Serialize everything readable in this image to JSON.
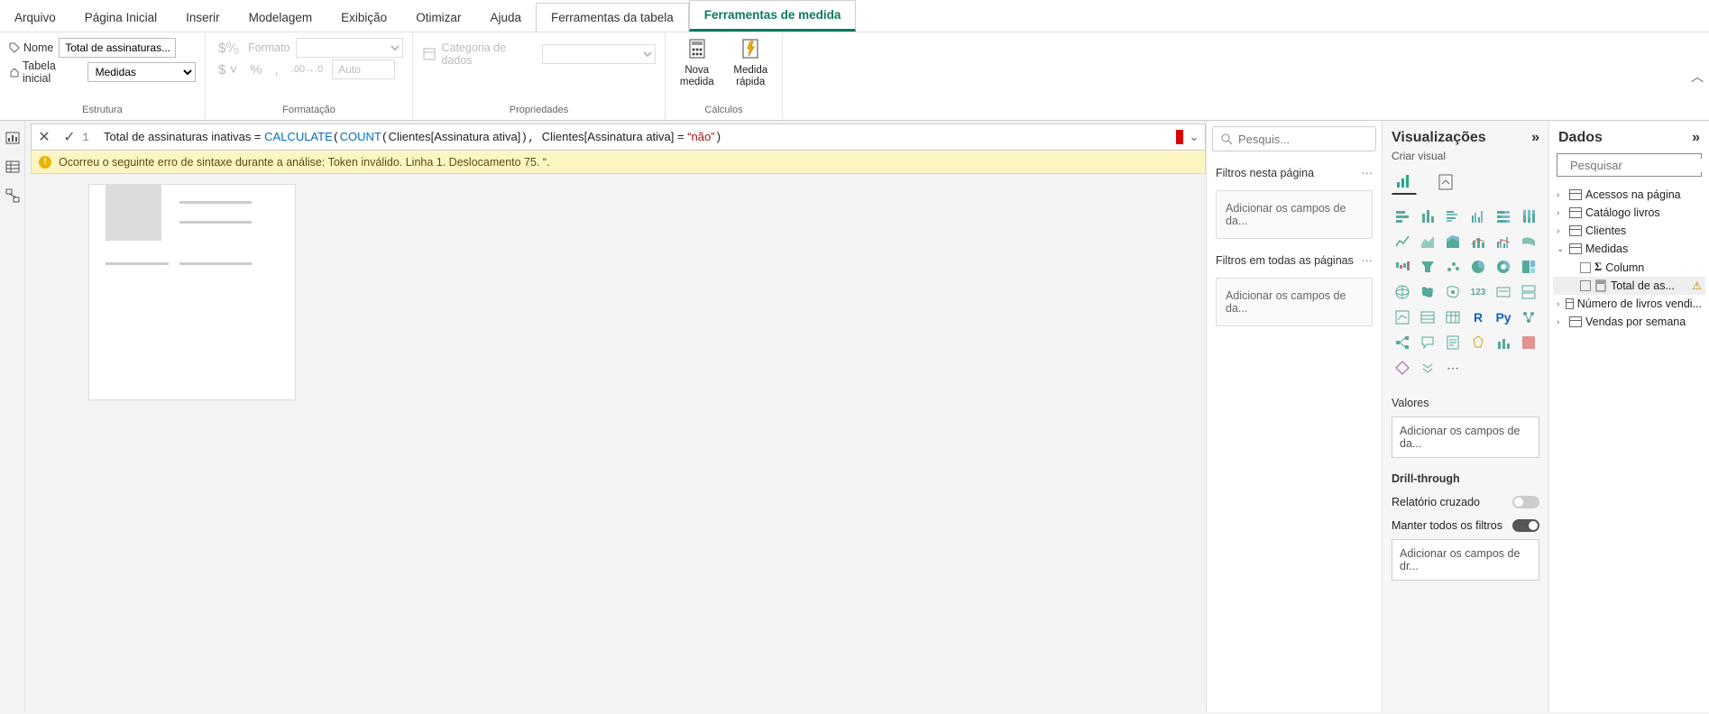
{
  "ribbon": {
    "tabs": [
      "Arquivo",
      "Página Inicial",
      "Inserir",
      "Modelagem",
      "Exibição",
      "Otimizar",
      "Ajuda",
      "Ferramentas da tabela",
      "Ferramentas de medida"
    ],
    "structure": {
      "name_label": "Nome",
      "name_value": "Total de assinaturas...",
      "home_table_label": "Tabela inicial",
      "home_table_value": "Medidas",
      "group_label": "Estrutura"
    },
    "formatting": {
      "format_label": "Formato",
      "auto_value": "Auto",
      "group_label": "Formatação"
    },
    "properties": {
      "category_label": "Categoria de dados",
      "group_label": "Propriedades"
    },
    "calculations": {
      "new_measure": "Nova medida",
      "quick_measure": "Medida rápida",
      "group_label": "Cálculos"
    }
  },
  "formula": {
    "line_no": "1",
    "measure_name": "Total de assinaturas inativas",
    "eq": " = ",
    "fn_calc": "CALCULATE",
    "fn_count": "COUNT",
    "tbl": "Clientes",
    "col": "[Assinatura ativa]",
    "op": " = ",
    "str_bad": "“não”",
    "full_display": "Total de assinaturas inativas = CALCULATE(COUNT(Clientes[Assinatura ativa]), Clientes[Assinatura ativa] = “não”)"
  },
  "error": {
    "message": "Ocorreu o seguinte erro de sintaxe durante a análise: Token inválido. Linha 1. Deslocamento 75. “."
  },
  "filters": {
    "search_placeholder": "Pesquis...",
    "page_title": "Filtros nesta página",
    "all_title": "Filtros em todas as páginas",
    "drop_text": "Adicionar os campos de da..."
  },
  "viz": {
    "title": "Visualizações",
    "subtitle": "Criar visual",
    "values_label": "Valores",
    "values_drop": "Adicionar os campos de da...",
    "drill_title": "Drill-through",
    "cross_report": "Relatório cruzado",
    "keep_filters": "Manter todos os filtros",
    "drill_drop": "Adicionar os campos de dr..."
  },
  "data": {
    "title": "Dados",
    "search_placeholder": "Pesquisar",
    "tables": [
      {
        "name": "Acessos na página",
        "expanded": false
      },
      {
        "name": "Catálogo livros",
        "expanded": false
      },
      {
        "name": "Clientes",
        "expanded": false
      },
      {
        "name": "Medidas",
        "expanded": true,
        "children": [
          {
            "name": "Column",
            "type": "sigma"
          },
          {
            "name": "Total de as...",
            "type": "measure",
            "error": true,
            "selected": true
          }
        ]
      },
      {
        "name": "Número de livros vendi...",
        "expanded": false
      },
      {
        "name": "Vendas por semana",
        "expanded": false
      }
    ]
  }
}
